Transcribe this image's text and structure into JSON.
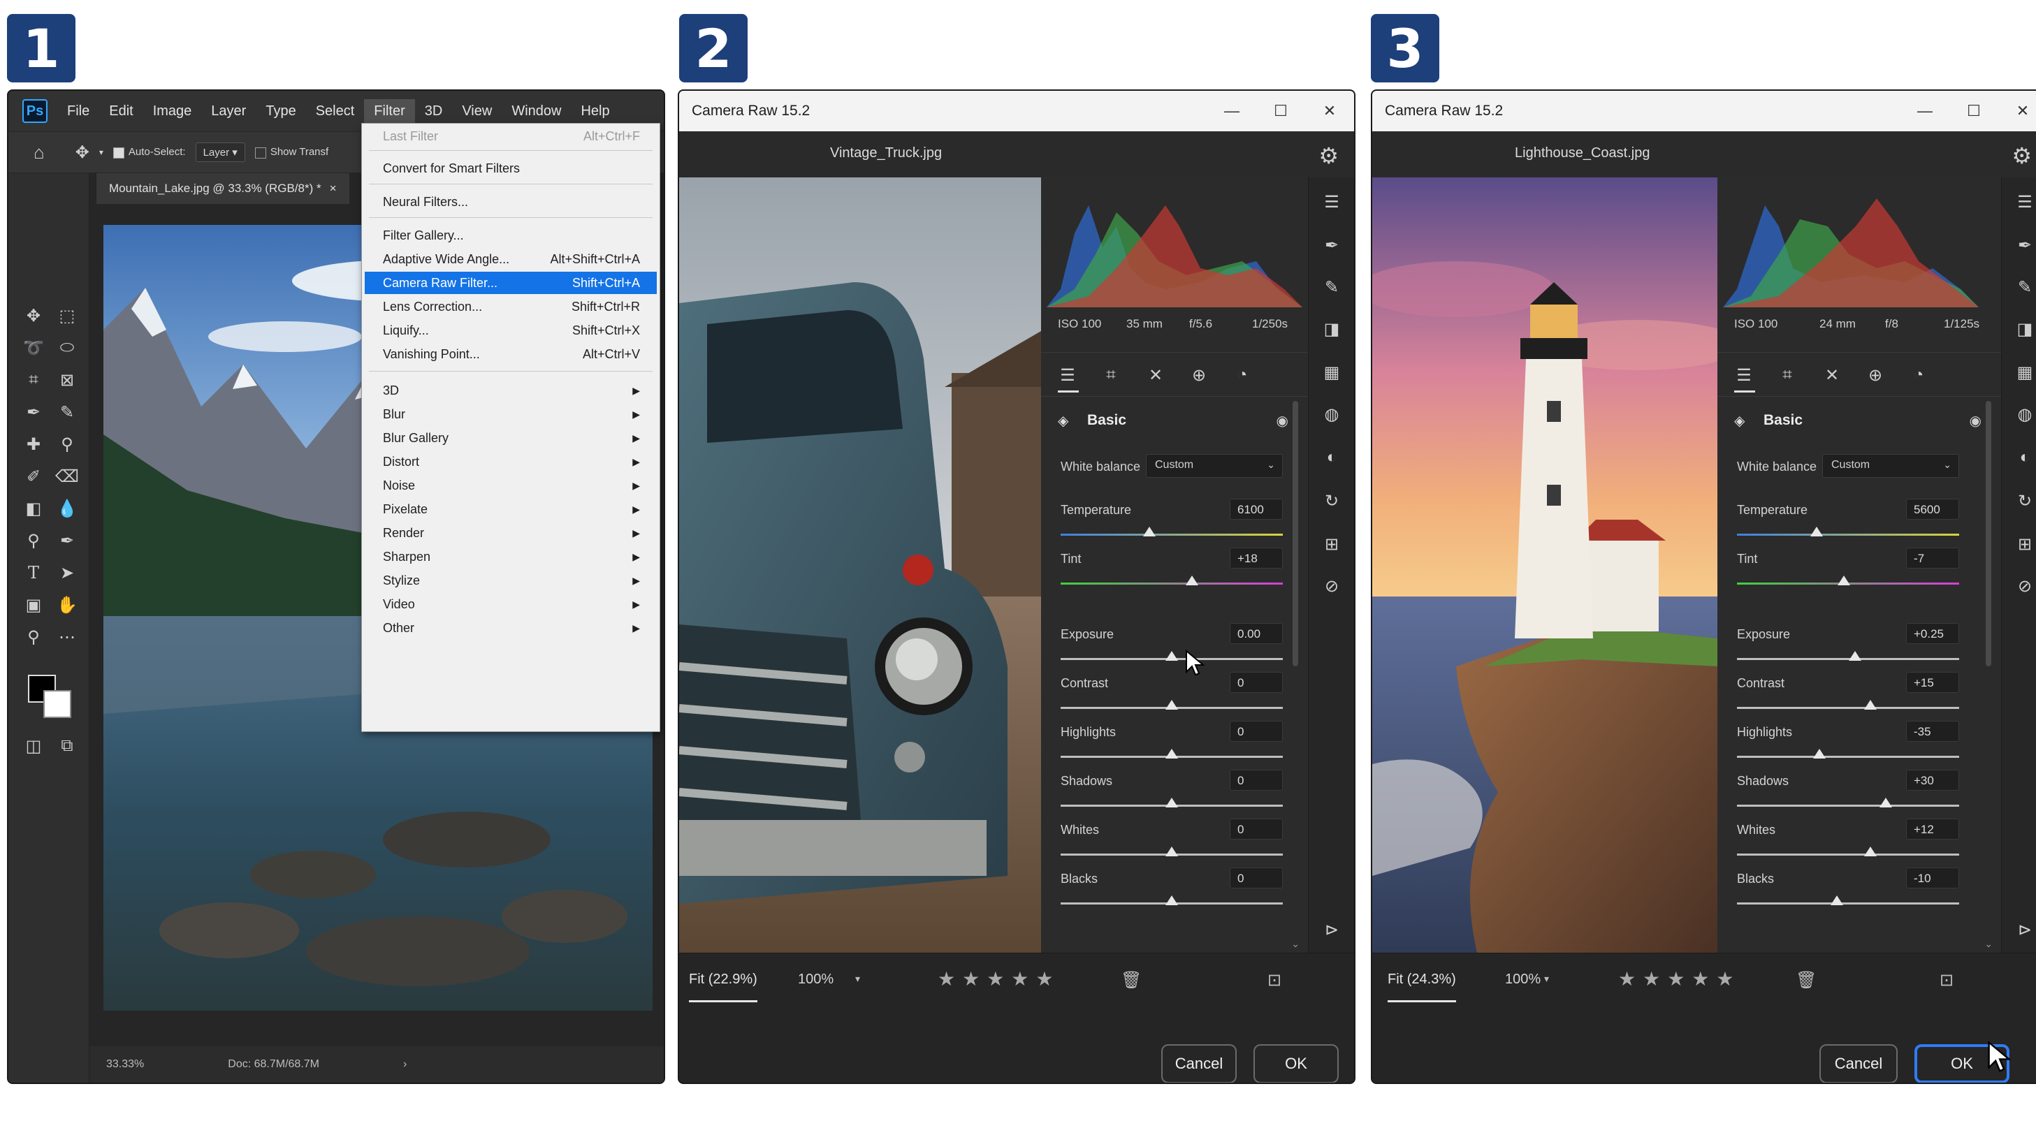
{
  "steps": [
    "1",
    "2",
    "3"
  ],
  "photoshop": {
    "logo": "Ps",
    "menus": [
      "File",
      "Edit",
      "Image",
      "Layer",
      "Type",
      "Select",
      "Filter",
      "3D",
      "View",
      "Window",
      "Help"
    ],
    "active_menu": "Filter",
    "options": {
      "auto_select_label": "Auto-Select:",
      "auto_select_target": "Layer",
      "show_transform_label": "Show Transf"
    },
    "document_tab": "Mountain_Lake.jpg @ 33.3% (RGB/8*) *",
    "document_tab_close": "×",
    "status": {
      "zoom": "33.33%",
      "doc_size": "Doc: 68.7M/68.7M",
      "arrow": "›"
    },
    "filter_menu": [
      {
        "label": "Last Filter",
        "shortcut": "Alt+Ctrl+F",
        "disabled": true
      },
      {
        "label": "Convert for Smart Filters",
        "shortcut": ""
      },
      {
        "label": "Neural Filters...",
        "shortcut": ""
      },
      {
        "label": "Filter Gallery...",
        "shortcut": ""
      },
      {
        "label": "Adaptive Wide Angle...",
        "shortcut": "Alt+Shift+Ctrl+A"
      },
      {
        "label": "Camera Raw Filter...",
        "shortcut": "Shift+Ctrl+A",
        "highlighted": true
      },
      {
        "label": "Lens Correction...",
        "shortcut": "Shift+Ctrl+R"
      },
      {
        "label": "Liquify...",
        "shortcut": "Shift+Ctrl+X"
      },
      {
        "label": "Vanishing Point...",
        "shortcut": "Alt+Ctrl+V"
      },
      {
        "label": "3D",
        "submenu": true
      },
      {
        "label": "Blur",
        "submenu": true
      },
      {
        "label": "Blur Gallery",
        "submenu": true
      },
      {
        "label": "Distort",
        "submenu": true
      },
      {
        "label": "Noise",
        "submenu": true
      },
      {
        "label": "Pixelate",
        "submenu": true
      },
      {
        "label": "Render",
        "submenu": true
      },
      {
        "label": "Sharpen",
        "submenu": true
      },
      {
        "label": "Stylize",
        "submenu": true
      },
      {
        "label": "Video",
        "submenu": true
      },
      {
        "label": "Other",
        "submenu": true
      }
    ]
  },
  "camera_raw": [
    {
      "title": "Camera Raw 15.2",
      "filename": "Vintage_Truck.jpg",
      "exif": {
        "iso": "ISO 100",
        "focal": "35 mm",
        "aperture": "f/5.6",
        "shutter": "1/250s"
      },
      "section": "Basic",
      "white_balance_label": "White balance",
      "white_balance_value": "Custom",
      "sliders": [
        {
          "label": "Temperature",
          "value": "6100",
          "position": 0.4
        },
        {
          "label": "Tint",
          "value": "+18",
          "position": 0.59
        },
        {
          "label": "Exposure",
          "value": "0.00",
          "position": 0.5
        },
        {
          "label": "Contrast",
          "value": "0",
          "position": 0.5
        },
        {
          "label": "Highlights",
          "value": "0",
          "position": 0.5
        },
        {
          "label": "Shadows",
          "value": "0",
          "position": 0.5
        },
        {
          "label": "Whites",
          "value": "0",
          "position": 0.5
        },
        {
          "label": "Blacks",
          "value": "0",
          "position": 0.5
        }
      ],
      "fit": "Fit (22.9%)",
      "zoom": "100%",
      "stars": "★★★★★",
      "cancel": "Cancel",
      "ok": "OK"
    },
    {
      "title": "Camera Raw 15.2",
      "filename": "Lighthouse_Coast.jpg",
      "exif": {
        "iso": "ISO 100",
        "focal": "24 mm",
        "aperture": "f/8",
        "shutter": "1/125s"
      },
      "section": "Basic",
      "white_balance_label": "White balance",
      "white_balance_value": "Custom",
      "sliders": [
        {
          "label": "Temperature",
          "value": "5600",
          "position": 0.36
        },
        {
          "label": "Tint",
          "value": "-7",
          "position": 0.48
        },
        {
          "label": "Exposure",
          "value": "+0.25",
          "position": 0.53
        },
        {
          "label": "Contrast",
          "value": "+15",
          "position": 0.6
        },
        {
          "label": "Highlights",
          "value": "-35",
          "position": 0.37
        },
        {
          "label": "Shadows",
          "value": "+30",
          "position": 0.67
        },
        {
          "label": "Whites",
          "value": "+12",
          "position": 0.6
        },
        {
          "label": "Blacks",
          "value": "-10",
          "position": 0.45
        }
      ],
      "fit": "Fit (24.3%)",
      "zoom": "100%",
      "stars": "★★★★★",
      "cancel": "Cancel",
      "ok": "OK"
    }
  ],
  "colors": {
    "badge": "#1d3f7a",
    "menu_highlight": "#1473e6",
    "ok_focus": "#2f7cf6"
  }
}
